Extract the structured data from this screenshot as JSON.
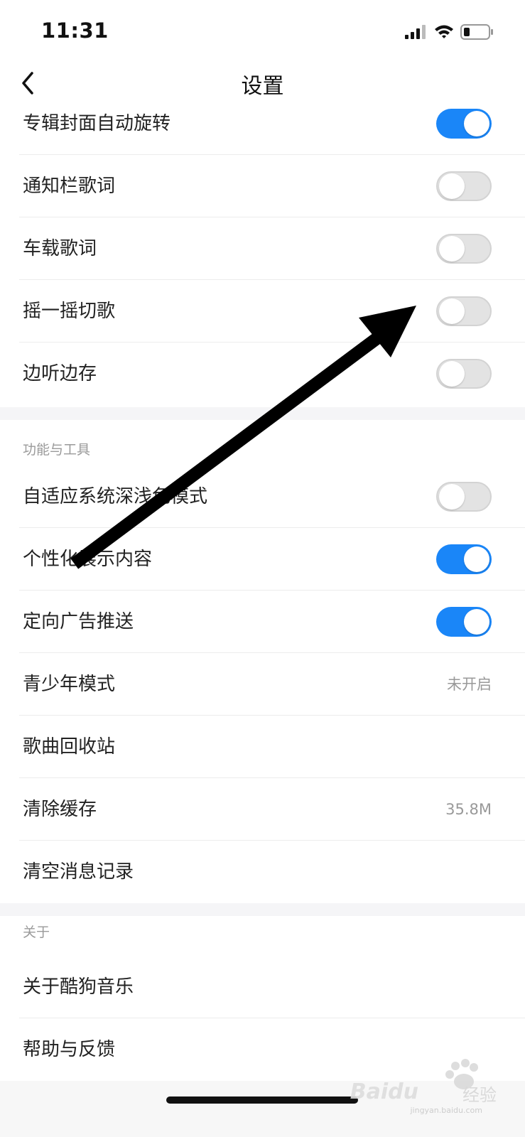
{
  "status_bar": {
    "time": "11:31"
  },
  "nav": {
    "title": "设置"
  },
  "rows_top": [
    {
      "label": "专辑封面自动旋转",
      "toggle": "on"
    },
    {
      "label": "通知栏歌词",
      "toggle": "off"
    },
    {
      "label": "车载歌词",
      "toggle": "off"
    },
    {
      "label": "摇一摇切歌",
      "toggle": "off"
    },
    {
      "label": "边听边存",
      "toggle": "off"
    }
  ],
  "section_tools": {
    "header": "功能与工具",
    "rows": [
      {
        "label": "自适应系统深浅色模式",
        "toggle": "off"
      },
      {
        "label": "个性化展示内容",
        "toggle": "on"
      },
      {
        "label": "定向广告推送",
        "toggle": "on"
      },
      {
        "label": "青少年模式",
        "value": "未开启"
      },
      {
        "label": "歌曲回收站"
      },
      {
        "label": "清除缓存",
        "value": "35.8M"
      },
      {
        "label": "清空消息记录"
      }
    ]
  },
  "section_about": {
    "header": "关于",
    "rows": [
      {
        "label": "关于酷狗音乐"
      },
      {
        "label": "帮助与反馈"
      }
    ]
  },
  "watermark": {
    "brand": "Baidu",
    "cn": "经验",
    "site": "jingyan.baidu.com"
  },
  "colors": {
    "accent": "#1a86f8",
    "toggle_off": "#e3e3e3",
    "section_gap": "#f5f5f7",
    "muted_text": "#999999"
  },
  "icons": [
    "back-chevron-icon",
    "cellular-signal-icon",
    "wifi-icon",
    "battery-icon",
    "annotation-arrow"
  ]
}
